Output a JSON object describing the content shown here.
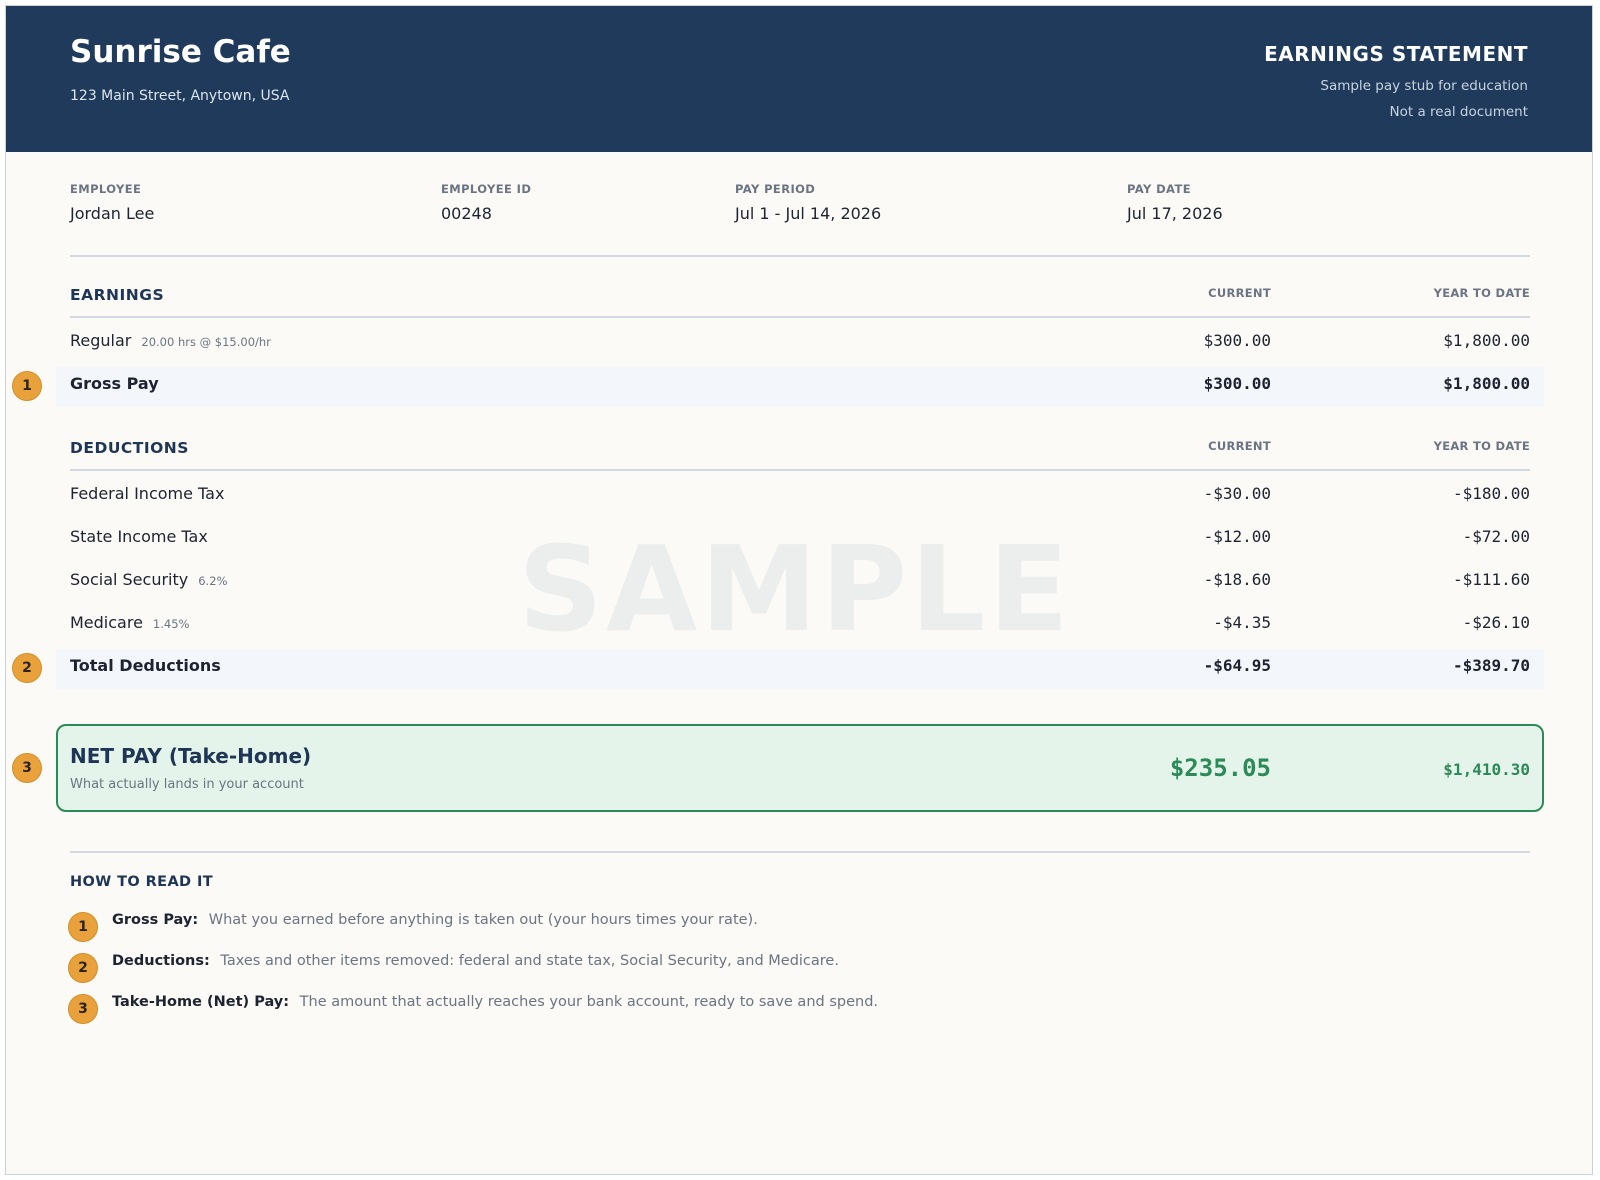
{
  "header": {
    "company": "Sunrise Cafe",
    "address": "123 Main Street, Anytown, USA",
    "doc_title": "EARNINGS STATEMENT",
    "subtitle_1": "Sample pay stub for education",
    "subtitle_2": "Not a real document"
  },
  "info": [
    {
      "label": "EMPLOYEE",
      "value": "Jordan Lee"
    },
    {
      "label": "EMPLOYEE ID",
      "value": "00248"
    },
    {
      "label": "PAY PERIOD",
      "value": "Jul 1 - Jul 14, 2026"
    },
    {
      "label": "PAY DATE",
      "value": "Jul 17, 2026"
    }
  ],
  "earnings": {
    "title": "EARNINGS",
    "col_current": "CURRENT",
    "col_ytd": "YEAR TO DATE",
    "rows": [
      {
        "label": "Regular",
        "note": "20.00 hrs @ $15.00/hr",
        "current": "$300.00",
        "ytd": "$1,800.00"
      }
    ],
    "total": {
      "marker": "1",
      "label": "Gross Pay",
      "current": "$300.00",
      "ytd": "$1,800.00"
    }
  },
  "deductions": {
    "title": "DEDUCTIONS",
    "col_current": "CURRENT",
    "col_ytd": "YEAR TO DATE",
    "rows": [
      {
        "label": "Federal Income Tax",
        "note": "",
        "current": "-$30.00",
        "ytd": "-$180.00"
      },
      {
        "label": "State Income Tax",
        "note": "",
        "current": "-$12.00",
        "ytd": "-$72.00"
      },
      {
        "label": "Social Security",
        "note": "6.2%",
        "current": "-$18.60",
        "ytd": "-$111.60"
      },
      {
        "label": "Medicare",
        "note": "1.45%",
        "current": "-$4.35",
        "ytd": "-$26.10"
      }
    ],
    "total": {
      "marker": "2",
      "label": "Total Deductions",
      "current": "-$64.95",
      "ytd": "-$389.70"
    }
  },
  "watermark": "SAMPLE",
  "net": {
    "marker": "3",
    "title": "NET PAY (Take-Home)",
    "subtitle": "What actually lands in your account",
    "current": "$235.05",
    "ytd": "$1,410.30"
  },
  "howto": {
    "title": "HOW TO READ IT",
    "items": [
      {
        "marker": "1",
        "term": "Gross Pay:",
        "text": "What you earned before anything is taken out (your hours times your rate)."
      },
      {
        "marker": "2",
        "term": "Deductions:",
        "text": "Taxes and other items removed: federal and state tax, Social Security, and Medicare."
      },
      {
        "marker": "3",
        "term": "Take-Home (Net) Pay:",
        "text": "The amount that actually reaches your bank account, ready to save and spend."
      }
    ]
  },
  "colors": {
    "header_bg": "#1f3a5a",
    "accent_green": "#2b8a57",
    "marker_orange": "#e9a23b"
  }
}
